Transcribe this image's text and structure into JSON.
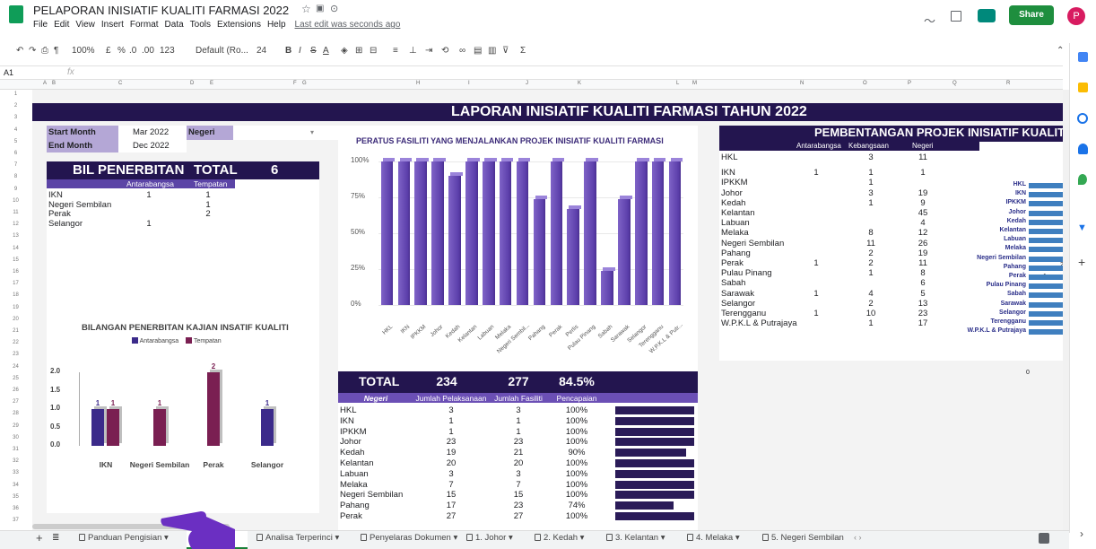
{
  "doc": {
    "title": "PELAPORAN INISIATIF KUALITI FARMASI 2022",
    "last_edit": "Last edit was seconds ago",
    "share": "Share",
    "avatar": "P",
    "cell_ref": "A1",
    "fx": "fx"
  },
  "menu": [
    "File",
    "Edit",
    "View",
    "Insert",
    "Format",
    "Data",
    "Tools",
    "Extensions",
    "Help"
  ],
  "toolbar": {
    "zoom": "100%",
    "currency": "£",
    "percent": "%",
    "dec0": ".0",
    "dec00": ".00",
    "fmt": "123",
    "font": "Default (Ro...",
    "size": "24"
  },
  "columns": [
    "A",
    "B",
    "C",
    "D",
    "E",
    "F",
    "G",
    "H",
    "I",
    "J",
    "K",
    "L",
    "M",
    "N",
    "O",
    "P",
    "Q",
    "R"
  ],
  "filters": {
    "start_label": "Start Month",
    "start_value": "Mar 2022",
    "negeri_label": "Negeri",
    "end_label": "End Month",
    "end_value": "Dec 2022"
  },
  "banner": "LAPORAN INISIATIF KUALITI FARMASI TAHUN 2022",
  "bil": {
    "title": "BIL PENERBITAN",
    "total_label": "TOTAL",
    "total": "6",
    "h1": "Antarabangsa",
    "h2": "Tempatan",
    "rows": [
      {
        "n": "IKN",
        "a": "1",
        "t": "1"
      },
      {
        "n": "Negeri Sembilan",
        "a": "",
        "t": "1"
      },
      {
        "n": "Perak",
        "a": "",
        "t": "2"
      },
      {
        "n": "Selangor",
        "a": "1",
        "t": ""
      }
    ]
  },
  "chart_data": [
    {
      "type": "bar",
      "title": "PERATUS FASILITI YANG MENJALANKAN PROJEK INISIATIF KUALITI FARMASI",
      "yticks": [
        "100%",
        "75%",
        "50%",
        "25%",
        "0%"
      ],
      "ylim": [
        0,
        100
      ],
      "categories": [
        "HKL",
        "IKN",
        "IPKKM",
        "Johor",
        "Kedah",
        "Kelantan",
        "Labuan",
        "Melaka",
        "Negeri Sembil...",
        "Pahang",
        "Perak",
        "Perlis",
        "Pulau Pinang",
        "Sabah",
        "Sarawak",
        "Selangor",
        "Terengganu",
        "W.P.K.L & Putr..."
      ],
      "values": [
        100,
        100,
        100,
        100,
        90,
        100,
        100,
        100,
        100,
        74,
        100,
        67,
        100,
        24,
        74,
        100,
        100,
        100
      ]
    },
    {
      "type": "bar",
      "title": "BILANGAN PENERBITAN KAJIAN INSATIF KUALITI",
      "yticks": [
        "2.0",
        "1.5",
        "1.0",
        "0.5",
        "0.0"
      ],
      "ylim": [
        0,
        2
      ],
      "categories": [
        "IKN",
        "Negeri Sembilan",
        "Perak",
        "Selangor"
      ],
      "series": [
        {
          "name": "Antarabangsa",
          "color": "#3b2a8a",
          "values": [
            1,
            null,
            null,
            1
          ]
        },
        {
          "name": "Tempatan",
          "color": "#7a1f52",
          "values": [
            1,
            1,
            2,
            null
          ]
        }
      ]
    }
  ],
  "total": {
    "title": "TOTAL",
    "v1": "234",
    "v2": "277",
    "v3": "84.5%",
    "h0": "Negeri",
    "h1": "Jumlah Pelaksanaan",
    "h2": "Jumlah Fasiliti",
    "h3": "Pencapaian",
    "rows": [
      {
        "n": "HKL",
        "a": "3",
        "b": "3",
        "p": "100%",
        "f": 1
      },
      {
        "n": "IKN",
        "a": "1",
        "b": "1",
        "p": "100%",
        "f": 1
      },
      {
        "n": "IPKKM",
        "a": "1",
        "b": "1",
        "p": "100%",
        "f": 1
      },
      {
        "n": "Johor",
        "a": "23",
        "b": "23",
        "p": "100%",
        "f": 1
      },
      {
        "n": "Kedah",
        "a": "19",
        "b": "21",
        "p": "90%",
        "f": 0.9
      },
      {
        "n": "Kelantan",
        "a": "20",
        "b": "20",
        "p": "100%",
        "f": 1
      },
      {
        "n": "Labuan",
        "a": "3",
        "b": "3",
        "p": "100%",
        "f": 1
      },
      {
        "n": "Melaka",
        "a": "7",
        "b": "7",
        "p": "100%",
        "f": 1
      },
      {
        "n": "Negeri Sembilan",
        "a": "15",
        "b": "15",
        "p": "100%",
        "f": 1
      },
      {
        "n": "Pahang",
        "a": "17",
        "b": "23",
        "p": "74%",
        "f": 0.74
      },
      {
        "n": "Perak",
        "a": "27",
        "b": "27",
        "p": "100%",
        "f": 1
      }
    ]
  },
  "pemb": {
    "title": "PEMBENTANGAN PROJEK INISIATIF KUALITI",
    "h1": "Antarabangsa",
    "h2": "Kebangsaan",
    "h3": "Negeri",
    "rows": [
      {
        "n": "HKL",
        "a": "",
        "k": "3",
        "g": "11"
      },
      {
        "n": "IKN",
        "a": "1",
        "k": "1",
        "g": "1"
      },
      {
        "n": "IPKKM",
        "a": "",
        "k": "1",
        "g": ""
      },
      {
        "n": "Johor",
        "a": "",
        "k": "3",
        "g": "19"
      },
      {
        "n": "Kedah",
        "a": "",
        "k": "1",
        "g": "9"
      },
      {
        "n": "Kelantan",
        "a": "",
        "k": "",
        "g": "45"
      },
      {
        "n": "Labuan",
        "a": "",
        "k": "",
        "g": "4"
      },
      {
        "n": "Melaka",
        "a": "",
        "k": "8",
        "g": "12"
      },
      {
        "n": "Negeri Sembilan",
        "a": "",
        "k": "11",
        "g": "26"
      },
      {
        "n": "Pahang",
        "a": "",
        "k": "2",
        "g": "19"
      },
      {
        "n": "Perak",
        "a": "1",
        "k": "2",
        "g": "11"
      },
      {
        "n": "Pulau Pinang",
        "a": "",
        "k": "1",
        "g": "8"
      },
      {
        "n": "Sabah",
        "a": "",
        "k": "",
        "g": "6"
      },
      {
        "n": "Sarawak",
        "a": "1",
        "k": "4",
        "g": "5"
      },
      {
        "n": "Selangor",
        "a": "",
        "k": "2",
        "g": "13"
      },
      {
        "n": "Terengganu",
        "a": "1",
        "k": "10",
        "g": "23"
      },
      {
        "n": "W.P.K.L & Putrajaya",
        "a": "",
        "k": "1",
        "g": "17"
      }
    ],
    "chart_labels": [
      "HKL",
      "IKN",
      "IPKKM",
      "Johor",
      "Kedah",
      "Kelantan",
      "Labuan",
      "Melaka",
      "Negeri Sembilan",
      "Pahang",
      "Perak",
      "Pulau Pinang",
      "Sabah",
      "Sarawak",
      "Selangor",
      "Terengganu",
      "W.P.K.L & Putrajaya"
    ],
    "zero": "0",
    "mini1": "1",
    "mini2": "2"
  },
  "tabs": [
    "Panduan Pengisian",
    "Analisa Terperinci",
    "Penyelaras Dokumen",
    "1. Johor",
    "2. Kedah",
    "3. Kelantan",
    "4. Melaka",
    "5. Negeri Sembilan"
  ]
}
